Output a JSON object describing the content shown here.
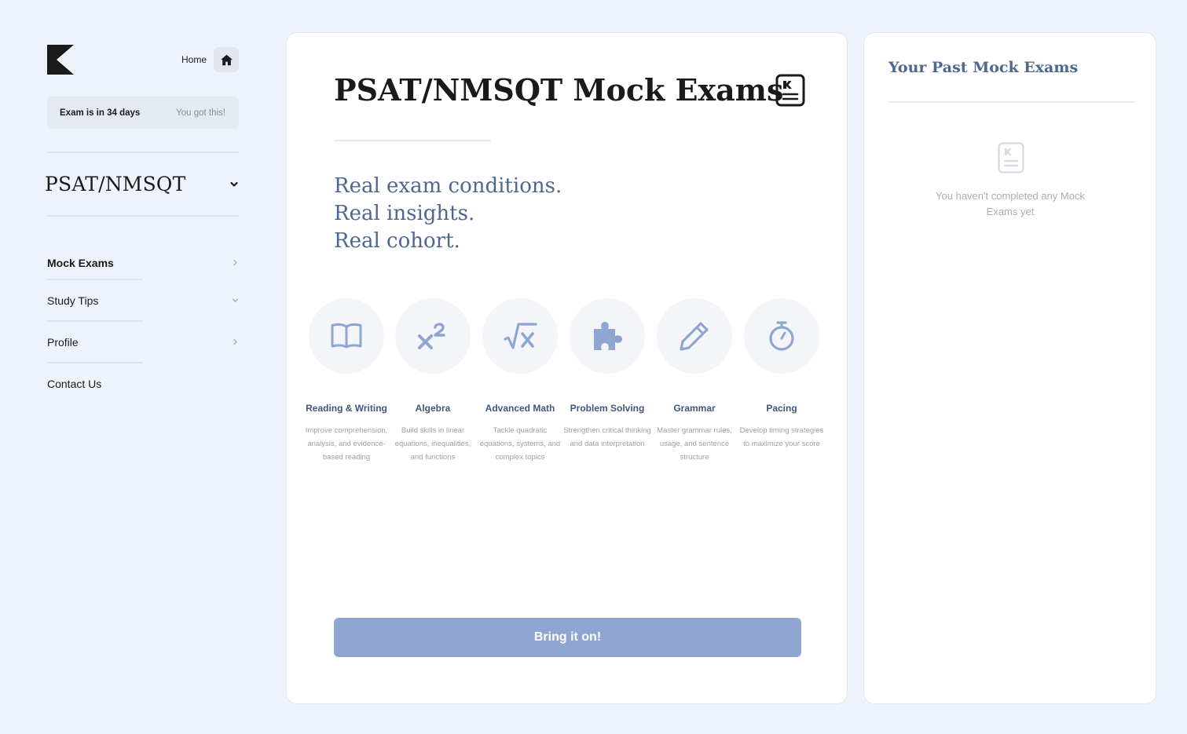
{
  "sidebar": {
    "home_label": "Home",
    "countdown": {
      "label": "Exam is in 34 days",
      "encouragement": "You got this!"
    },
    "exam_selector": {
      "value": "PSAT/NMSQT"
    },
    "nav": [
      {
        "label": "Mock Exams",
        "chevron": "chevron-right",
        "active": true
      },
      {
        "label": "Study Tips",
        "chevron": "chevron-down"
      },
      {
        "label": "Profile",
        "chevron": "chevron-right"
      },
      {
        "label": "Contact Us"
      }
    ]
  },
  "main": {
    "title": "PSAT/NMSQT Mock Exams",
    "tagline": [
      "Real exam conditions.",
      "Real insights.",
      "Real cohort."
    ],
    "features": [
      {
        "name": "Reading & Writing",
        "description": "Improve comprehension, analysis, and evidence-based reading",
        "icon": "open-book-icon"
      },
      {
        "name": "Algebra",
        "description": "Build skills in linear equations, inequalities, and functions",
        "icon": "x-squared-icon"
      },
      {
        "name": "Advanced Math",
        "description": "Tackle quadratic equations, systems, and complex topics",
        "icon": "square-root-icon"
      },
      {
        "name": "Problem Solving",
        "description": "Strengthen critical thinking and data interpretation",
        "icon": "puzzle-icon"
      },
      {
        "name": "Grammar",
        "description": "Master grammar rules, usage, and sentence structure",
        "icon": "pencil-icon"
      },
      {
        "name": "Pacing",
        "description": "Develop timing strategies to maximize your score",
        "icon": "stopwatch-icon"
      }
    ],
    "cta_label": "Bring it on!"
  },
  "past_exams": {
    "title": "Your Past Mock Exams",
    "empty_message": "You haven't completed any Mock Exams yet"
  },
  "colors": {
    "background": "#eef2fa",
    "accent_text": "#4d6790",
    "icon_blue": "#8fa6d3",
    "button": "#8fa6d3",
    "feature_label": "#43557a"
  }
}
